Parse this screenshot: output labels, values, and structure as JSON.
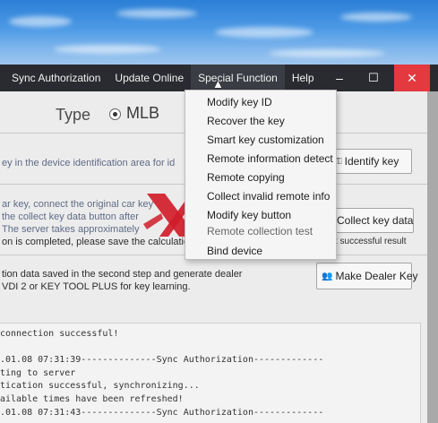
{
  "menubar": {
    "items": [
      "Sync Authorization",
      "Update Online",
      "Special Function",
      "Help"
    ],
    "window_controls": {
      "minimize": "–",
      "maximize": "☐",
      "close": "✕"
    }
  },
  "type_row": {
    "label": "Type",
    "selected_option": "MLB"
  },
  "special_function_menu": {
    "items": [
      "Modify key ID",
      "Recover the key",
      "Smart key customization",
      "Remote information detect",
      "Remote copying",
      "Collect invalid remote info",
      "Modify key button",
      "Remote collection test",
      "Bind device"
    ]
  },
  "steps": {
    "step1_text": "ey in the device identification area for id",
    "identify_button": "Identify key",
    "step2_lines": [
      "ar key, connect the original car key",
      "the collect key data button after",
      "The server takes approximately",
      "on is completed, please save the calculation"
    ],
    "collect_button": "Collect key data",
    "collect_status": "t successful result",
    "step3_lines": [
      "tion data saved in the second step and generate dealer",
      "VDI 2 or KEY TOOL PLUS for key learning."
    ],
    "dealer_button": "Make Dealer Key"
  },
  "log": {
    "lines": [
      " connection successful!",
      "",
      ".01.08 07:31:39--------------Sync Authorization-------------",
      "ting to server",
      "tication successful, synchronizing...",
      "ailable times have been refreshed!",
      ".01.08 07:31:43--------------Sync Authorization-------------"
    ]
  },
  "watermark": {
    "brand": "xhorsevvdi"
  },
  "colors": {
    "menubar_bg": "#2a2b30",
    "close_red": "#e4393f",
    "watermark_red": "#d01d2a"
  }
}
